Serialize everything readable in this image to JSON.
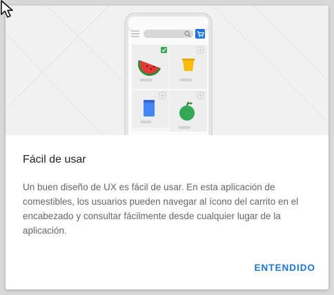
{
  "dialog": {
    "title": "Fácil de usar",
    "body": "Un buen diseño de UX es fácil de usar. En esta aplicación de comestibles, los usuarios pueden navegar al ícono del carrito en el encabezado y consultar fácilmente desde cualquier lugar de la aplicación.",
    "button_label": "ENTENDIDO"
  },
  "illustration": {
    "product_icons": [
      "watermelon-icon",
      "yellow-cup-icon",
      "blue-bottle-icon",
      "green-apple-icon"
    ],
    "header_icons": [
      "menu-icon",
      "search-bar",
      "cart-icon"
    ]
  },
  "colors": {
    "accent": "#1a73e8",
    "check": "#34a853"
  }
}
